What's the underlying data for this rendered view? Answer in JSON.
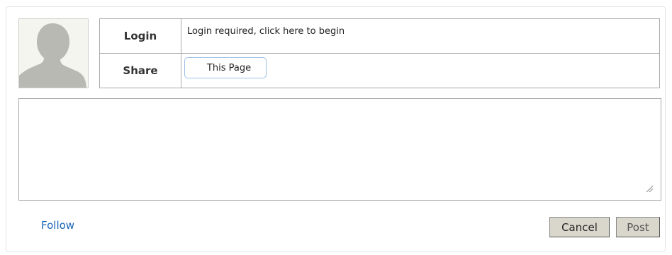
{
  "login": {
    "label": "Login",
    "text": "Login required, click here to begin"
  },
  "share": {
    "label": "Share",
    "button_label": "This Page"
  },
  "comment": {
    "value": ""
  },
  "footer": {
    "follow_label": "Follow",
    "cancel_label": "Cancel",
    "post_label": "Post"
  },
  "icons": {
    "avatar": "user-silhouette-icon",
    "resize": "resize-grip-icon"
  },
  "colors": {
    "link": "#1a66b8",
    "button_bg": "#d9d6cc",
    "share_border": "#9cc0e6"
  }
}
